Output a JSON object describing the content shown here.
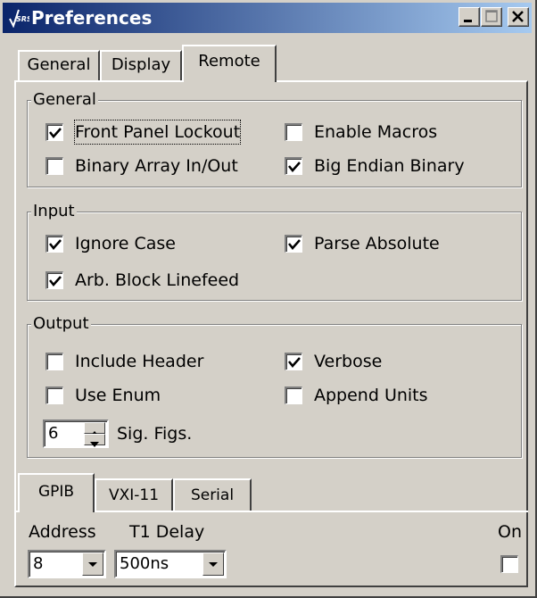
{
  "window": {
    "icon": "srs-logo-icon",
    "title": "Preferences",
    "minimize": "_",
    "maximize": "□",
    "close": "×"
  },
  "tabs": [
    {
      "label": "General"
    },
    {
      "label": "Display"
    },
    {
      "label": "Remote",
      "selected": true
    }
  ],
  "general_group": {
    "title": "General",
    "front_panel_lockout": {
      "label": "Front Panel Lockout",
      "checked": true
    },
    "enable_macros": {
      "label": "Enable Macros",
      "checked": false
    },
    "binary_array": {
      "label": "Binary Array In/Out",
      "checked": false
    },
    "big_endian": {
      "label": "Big Endian Binary",
      "checked": true
    }
  },
  "input_group": {
    "title": "Input",
    "ignore_case": {
      "label": "Ignore Case",
      "checked": true
    },
    "parse_absolute": {
      "label": "Parse Absolute",
      "checked": true
    },
    "arb_block": {
      "label": "Arb. Block Linefeed",
      "checked": true
    }
  },
  "output_group": {
    "title": "Output",
    "include_header": {
      "label": "Include Header",
      "checked": false
    },
    "verbose": {
      "label": "Verbose",
      "checked": true
    },
    "use_enum": {
      "label": "Use Enum",
      "checked": false
    },
    "append_units": {
      "label": "Append Units",
      "checked": false
    },
    "sig_figs": {
      "value": "6",
      "label": "Sig. Figs."
    }
  },
  "interface_tabs": [
    {
      "label": "GPIB",
      "selected": true
    },
    {
      "label": "VXI-11"
    },
    {
      "label": "Serial"
    }
  ],
  "gpib": {
    "address_label": "Address",
    "address_value": "8",
    "t1_delay_label": "T1 Delay",
    "t1_delay_value": "500ns",
    "on_label": "On",
    "on_checked": false
  }
}
